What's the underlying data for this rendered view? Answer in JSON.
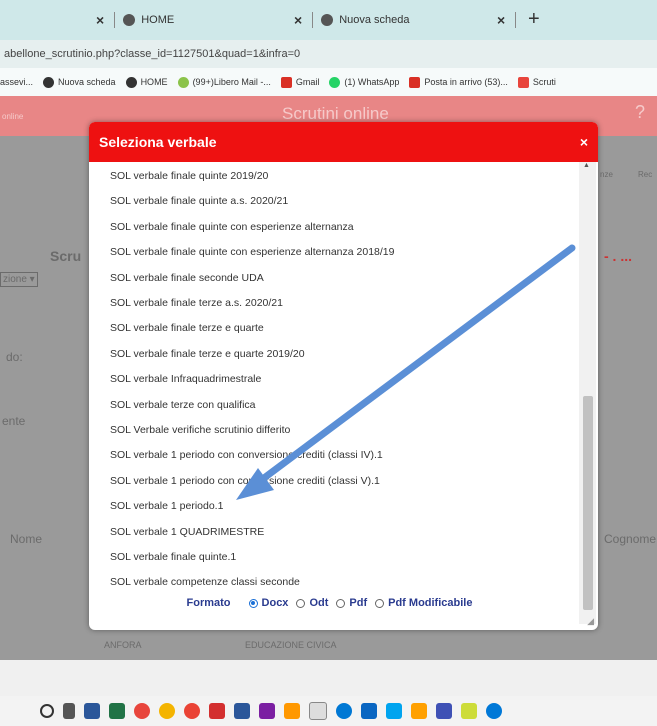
{
  "browser": {
    "tabs": [
      {
        "label": "HOME"
      },
      {
        "label": "Nuova scheda"
      },
      {
        "label": ""
      }
    ],
    "new_tab": "+",
    "url": "abellone_scrutinio.php?classe_id=1127501&quad=1&infra=0",
    "bookmarks": [
      {
        "label": "assevi..."
      },
      {
        "label": "Nuova scheda"
      },
      {
        "label": "HOME"
      },
      {
        "label": "(99+)Libero Mail -..."
      },
      {
        "label": "Gmail"
      },
      {
        "label": "(1) WhatsApp"
      },
      {
        "label": "Posta in arrivo (53)..."
      },
      {
        "label": "Scruti"
      }
    ]
  },
  "app": {
    "title": "Scrutini online",
    "help": "?",
    "left_link": "online",
    "bg_labels": {
      "scru": "Scru",
      "dots": "- . ...",
      "select": "zione ▾",
      "lbl1": "do:",
      "lbl2": "ente",
      "nome": "Nome",
      "cognome": "Cognome",
      "tool1": "nze",
      "tool2": "Rec",
      "footer_left": "ANFORA",
      "footer_right": "EDUCAZIONE CIVICA"
    }
  },
  "modal": {
    "title": "Seleziona verbale",
    "close": "×",
    "items": [
      "SOL verbale finale quinte 2019/20",
      "SOL verbale finale quinte a.s. 2020/21",
      "SOL verbale finale quinte con esperienze alternanza",
      "SOL verbale finale quinte con esperienze alternanza 2018/19",
      "SOL verbale finale seconde UDA",
      "SOL verbale finale terze a.s. 2020/21",
      "SOL verbale finale terze e quarte",
      "SOL verbale finale terze e quarte 2019/20",
      "SOL verbale Infraquadrimestrale",
      "SOL verbale terze con qualifica",
      "SOL Verbale verifiche scrutinio differito",
      "SOL verbale 1 periodo con conversione crediti (classi IV).1",
      "SOL verbale 1 periodo con conversione crediti (classi V).1",
      "SOL verbale 1 periodo.1",
      "SOL verbale 1 QUADRIMESTRE",
      "SOL verbale finale quinte.1",
      "SOL verbale competenze classi seconde"
    ],
    "format": {
      "label": "Formato",
      "options": [
        "Docx",
        "Odt",
        "Pdf",
        "Pdf Modificabile"
      ],
      "selected": "Docx"
    }
  },
  "colors": {
    "header_red": "#ee1111",
    "format_blue": "#2a3b8f",
    "arrow_blue": "#5b8fd6"
  }
}
